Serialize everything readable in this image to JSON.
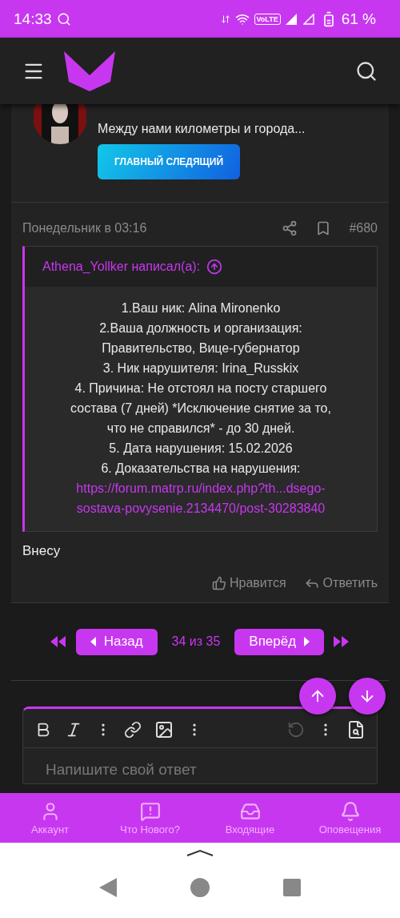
{
  "status_bar": {
    "time": "14:33",
    "volte": "VoLTE",
    "battery": "61 %"
  },
  "post": {
    "signature": "Между нами километры и города...",
    "banner": "ГЛАВНЫЙ СЛЕДЯЩИЙ",
    "date": "Понедельник в 03:16",
    "number": "#680",
    "quote": {
      "author": "Athena_Yollker написал(а):",
      "lines": [
        "1.Ваш ник: Alina Mironenko",
        "2.Ваша должность и организация:",
        "Правительство, Вице-губернатор",
        "3. Ник нарушителя: Irina_Russkix",
        "4. Причина: Не отстоял на посту старшего",
        "состава (7 дней) *Исключение снятие за то,",
        "что не справился* - до 30 дней.",
        "5. Дата нарушения: 15.02.2026",
        "6. Доказательства на нарушения:"
      ],
      "link": [
        "https://forum.matrp.ru/index.php?th...dsego-",
        "sostava-povysenie.2134470/post-30283840"
      ]
    },
    "body": "Внесу",
    "actions": [
      {
        "kind": "like",
        "label": "Нравится"
      },
      {
        "kind": "reply",
        "label": "Ответить"
      }
    ]
  },
  "pagination": {
    "prev": "Назад",
    "page": "34 из 35",
    "next": "Вперёд"
  },
  "editor": {
    "placeholder": "Напишите свой ответ"
  },
  "bottom_nav": [
    {
      "kind": "account",
      "label": "Аккаунт"
    },
    {
      "kind": "news",
      "label": "Что Нового?"
    },
    {
      "kind": "inbox",
      "label": "Входящие"
    },
    {
      "kind": "alerts",
      "label": "Оповещения"
    }
  ]
}
